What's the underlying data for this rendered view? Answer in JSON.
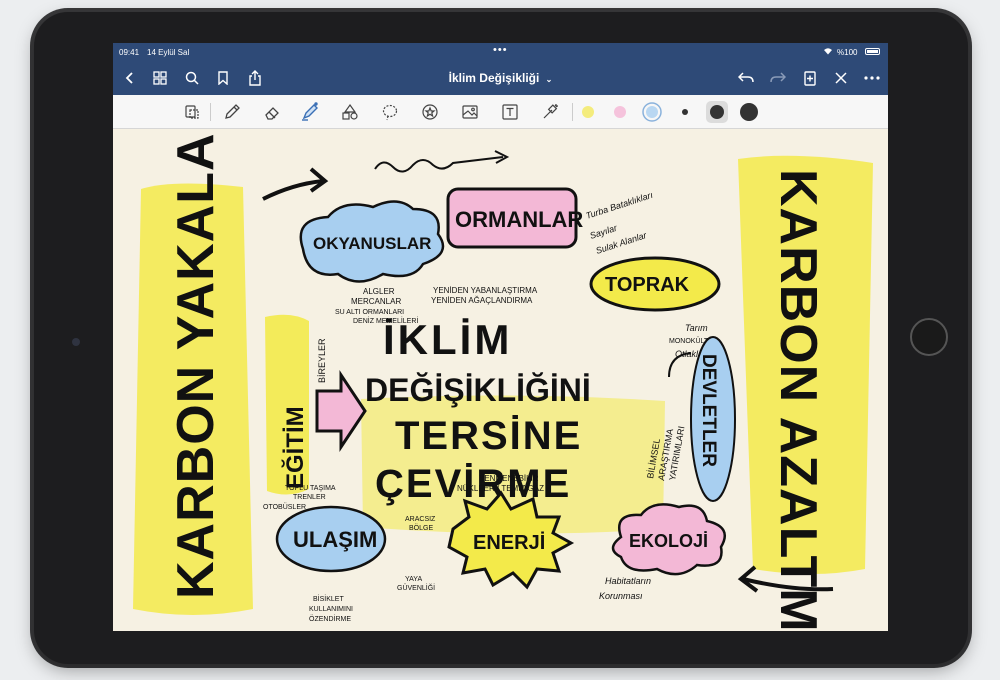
{
  "status": {
    "time": "09:41",
    "date": "14 Eylül Sal",
    "battery": "%100"
  },
  "nav": {
    "title": "İklim Değişikliği",
    "icons": [
      "back-icon",
      "grid-icon",
      "search-icon",
      "bookmark-icon",
      "share-icon",
      "undo-icon",
      "redo-icon",
      "add-page-icon",
      "close-icon",
      "more-icon"
    ]
  },
  "toolbar": {
    "tools": [
      "lasso-doc-icon",
      "pen-icon",
      "eraser-icon",
      "highlighter-icon",
      "shapes-icon",
      "lasso-icon",
      "sticker-icon",
      "image-icon",
      "text-icon",
      "laser-icon"
    ],
    "colors": [
      "#f4ec7d",
      "#f5c3dc",
      "#b9d7f2"
    ],
    "sizes": [
      "small",
      "medium",
      "large"
    ]
  },
  "note": {
    "heading": [
      "İKLİM",
      "DEĞİŞİKLİĞİNİ",
      "TERSİNE",
      "ÇEVİRME"
    ],
    "left_vertical": "KARBON YAKALAMA",
    "right_vertical": "KARBON AZALTMA",
    "okyanuslar": "OKYANUSLAR",
    "okyanuslar_notes": [
      "ALGLER",
      "MERCANLAR",
      "SU ALTI ORMANLARI",
      "DENİZ MEMELİLERİ"
    ],
    "ormanlar": "ORMANLAR",
    "ormanlar_notes": [
      "YENİDEN YABANLAŞTIRMA",
      "YENİDEN AĞAÇLANDIRMA"
    ],
    "toprak": "TOPRAK",
    "toprak_notes": [
      "Turba Bataklıkları",
      "Sayılar",
      "Sulak Alanlar"
    ],
    "tarim_notes": [
      "Tarım",
      "MONOKÜLTÜR",
      "Otlaklar"
    ],
    "egitim": "EĞİTİM",
    "bireyler": "BİREYLER",
    "devletler": "DEVLETLER",
    "devletler_notes": [
      "BİLİMSEL",
      "ARAŞTIRMA",
      "YATIRIMLARI"
    ],
    "ulasim": "ULAŞIM",
    "ulasim_notes": [
      "TOPLU TAŞIMA",
      "TRENLER",
      "OTOBÜSLER",
      "ARACSIZ",
      "BÖLGE",
      "YAYA",
      "GÜVENLİĞİ",
      "BİSİKLET",
      "KULLANIMINI",
      "ÖZENDİRME"
    ],
    "enerji": "ENERJİ",
    "enerji_notes": [
      "YENİLENEBİLİR",
      "NÜKLEER / TEMİZ GAZ"
    ],
    "ekoloji": "EKOLOJİ",
    "ekoloji_notes": [
      "Habitatların",
      "Korunması"
    ]
  }
}
